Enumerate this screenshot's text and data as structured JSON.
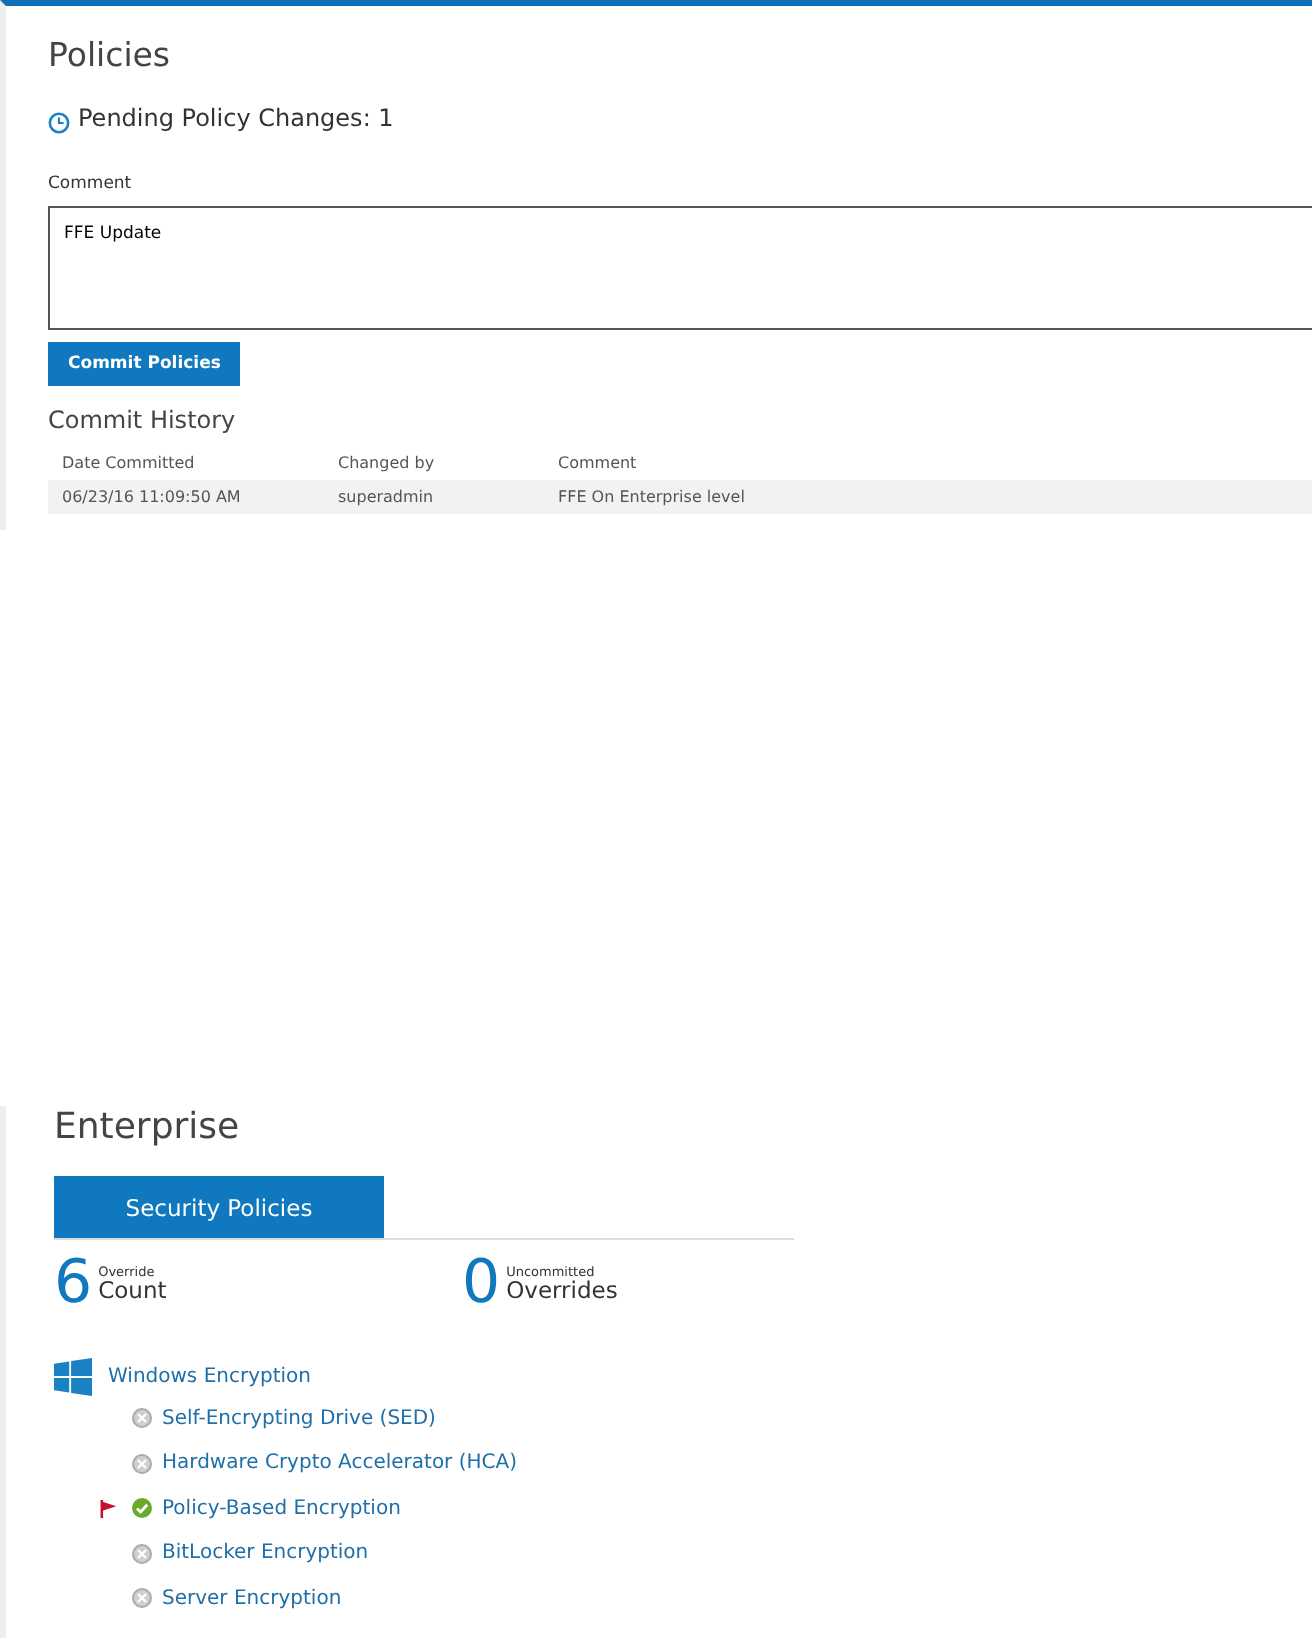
{
  "policies": {
    "title": "Policies",
    "pending": "Pending Policy Changes: 1",
    "comment_label": "Comment",
    "comment_value": "FFE Update",
    "commit_button": "Commit Policies",
    "history_title": "Commit History",
    "columns": [
      "Date Committed",
      "Changed by",
      "Comment"
    ],
    "rows": [
      [
        "06/23/16 11:09:50 AM",
        "superadmin",
        "FFE On Enterprise level"
      ]
    ]
  },
  "enterprise": {
    "title": "Enterprise",
    "tabs": [
      {
        "label": "Security Policies",
        "selected": true
      }
    ],
    "stats": [
      {
        "number": "6",
        "small": "Override",
        "large": "Count"
      },
      {
        "number": "0",
        "small": "Uncommitted",
        "large": "Overrides"
      }
    ],
    "group": {
      "label": "Windows Encryption",
      "children": [
        {
          "label": "Self-Encrypting Drive (SED)",
          "enabled": false,
          "flagged": false
        },
        {
          "label": "Hardware Crypto Accelerator (HCA)",
          "enabled": false,
          "flagged": false
        },
        {
          "label": "Policy-Based Encryption",
          "enabled": true,
          "flagged": true
        },
        {
          "label": "BitLocker Encryption",
          "enabled": false,
          "flagged": false
        },
        {
          "label": "Server Encryption",
          "enabled": false,
          "flagged": false
        }
      ]
    }
  }
}
